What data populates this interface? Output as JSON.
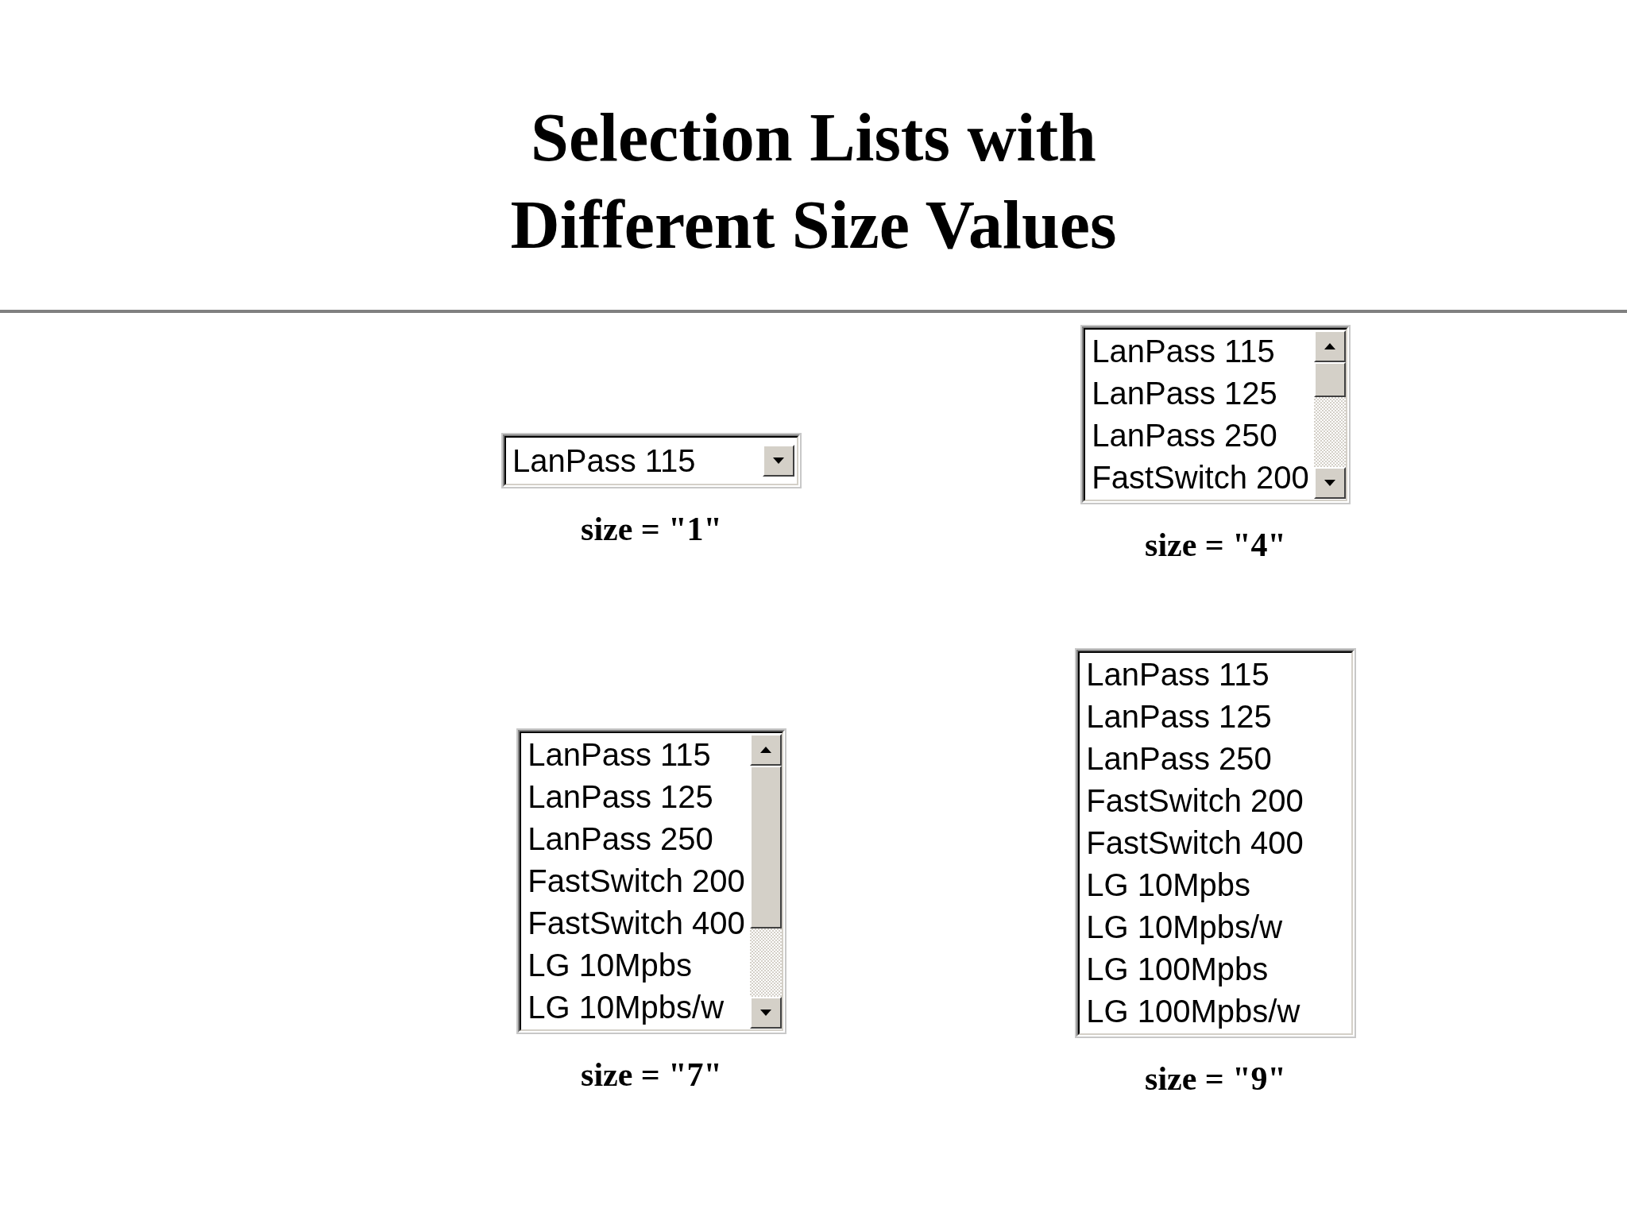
{
  "title": [
    "Selection Lists with",
    "Different Size Values"
  ],
  "lists": [
    {
      "kind": "dropdown",
      "caption": "size = \"1\"",
      "items": [
        "LanPass 115"
      ]
    },
    {
      "kind": "scrolled",
      "caption": "size = \"4\"",
      "items": [
        "LanPass 115",
        "LanPass 125",
        "LanPass 250",
        "FastSwitch 200"
      ]
    },
    {
      "kind": "scrolled",
      "caption": "size = \"7\"",
      "items": [
        "LanPass 115",
        "LanPass 125",
        "LanPass 250",
        "FastSwitch 200",
        "FastSwitch 400",
        "LG 10Mpbs",
        "LG 10Mpbs/w"
      ]
    },
    {
      "kind": "plain",
      "caption": "size = \"9\"",
      "items": [
        "LanPass 115",
        "LanPass 125",
        "LanPass 250",
        "FastSwitch 200",
        "FastSwitch 400",
        "LG 10Mpbs",
        "LG 10Mpbs/w",
        "LG 100Mpbs",
        "LG 100Mpbs/w"
      ]
    }
  ]
}
